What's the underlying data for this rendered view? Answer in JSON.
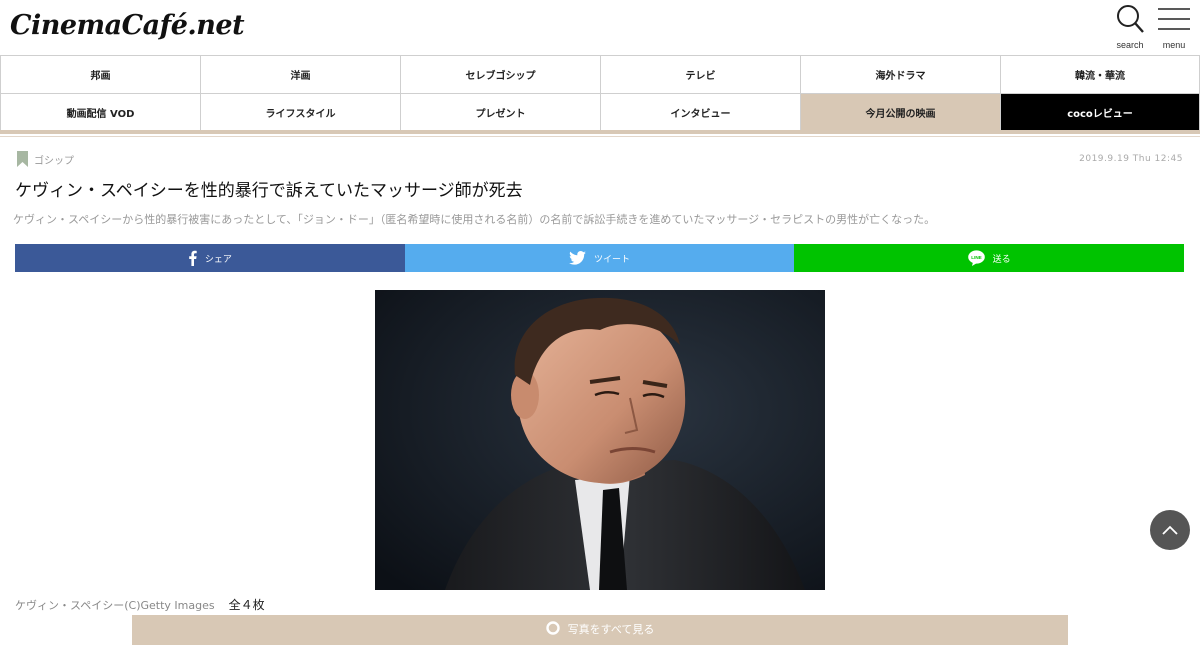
{
  "header": {
    "logo": "CinemaCafé.net",
    "search_label": "search",
    "menu_label": "menu"
  },
  "nav": {
    "row1": [
      "邦画",
      "洋画",
      "セレブゴシップ",
      "テレビ",
      "海外ドラマ",
      "韓流・華流"
    ],
    "row2": [
      "動画配信 VOD",
      "ライフスタイル",
      "プレゼント",
      "インタビュー",
      "今月公開の映画",
      "cocoレビュー"
    ]
  },
  "article": {
    "category": "ゴシップ",
    "date": "2019.9.19 Thu 12:45",
    "title": "ケヴィン・スペイシーを性的暴行で訴えていたマッサージ師が死去",
    "lead": "ケヴィン・スペイシーから性的暴行被害にあったとして、「ジョン・ドー」（匿名希望時に使用される名前）の名前で訴訟手続きを進めていたマッサージ・セラピストの男性が亡くなった。"
  },
  "share": {
    "facebook_label": "シェア",
    "twitter_label": "ツイート",
    "line_label": "送る"
  },
  "photo": {
    "caption": "ケヴィン・スペイシー(C)Getty Images",
    "count": "全４枚"
  },
  "all_photos_button": "写真をすべて見る",
  "colors": {
    "accent_beige": "#d8c8b5",
    "facebook": "#3b5998",
    "twitter": "#55acee",
    "line": "#00c300"
  }
}
